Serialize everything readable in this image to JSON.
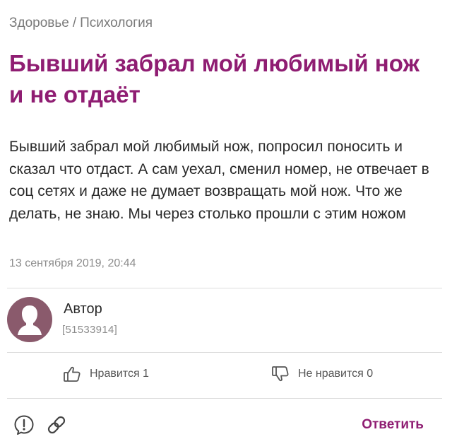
{
  "breadcrumb": {
    "category": "Здоровье",
    "separator": "/",
    "subcategory": "Психология"
  },
  "post": {
    "title": "Бывший забрал мой любимый нож и не отдаёт",
    "body": "Бывший забрал мой любимый нож, попросил поносить и сказал что отдаст. А сам уехал, сменил номер, не отвечает в соц сетях и даже не думает возвращать мой нож. Что же делать, не знаю. Мы через столько прошли с этим ножом",
    "date": "13 сентября 2019, 20:44"
  },
  "author": {
    "name": "Автор",
    "id": "[51533914]"
  },
  "actions": {
    "like_label": "Нравится 1",
    "dislike_label": "Не нравится 0",
    "reply_label": "Ответить"
  },
  "icons": {
    "avatar": "user-silhouette-icon",
    "like": "thumbs-up-icon",
    "dislike": "thumbs-down-icon",
    "report": "exclamation-circle-icon",
    "link": "link-icon"
  },
  "colors": {
    "accent": "#8f1d72",
    "avatar_bg": "#8a5a6c"
  }
}
